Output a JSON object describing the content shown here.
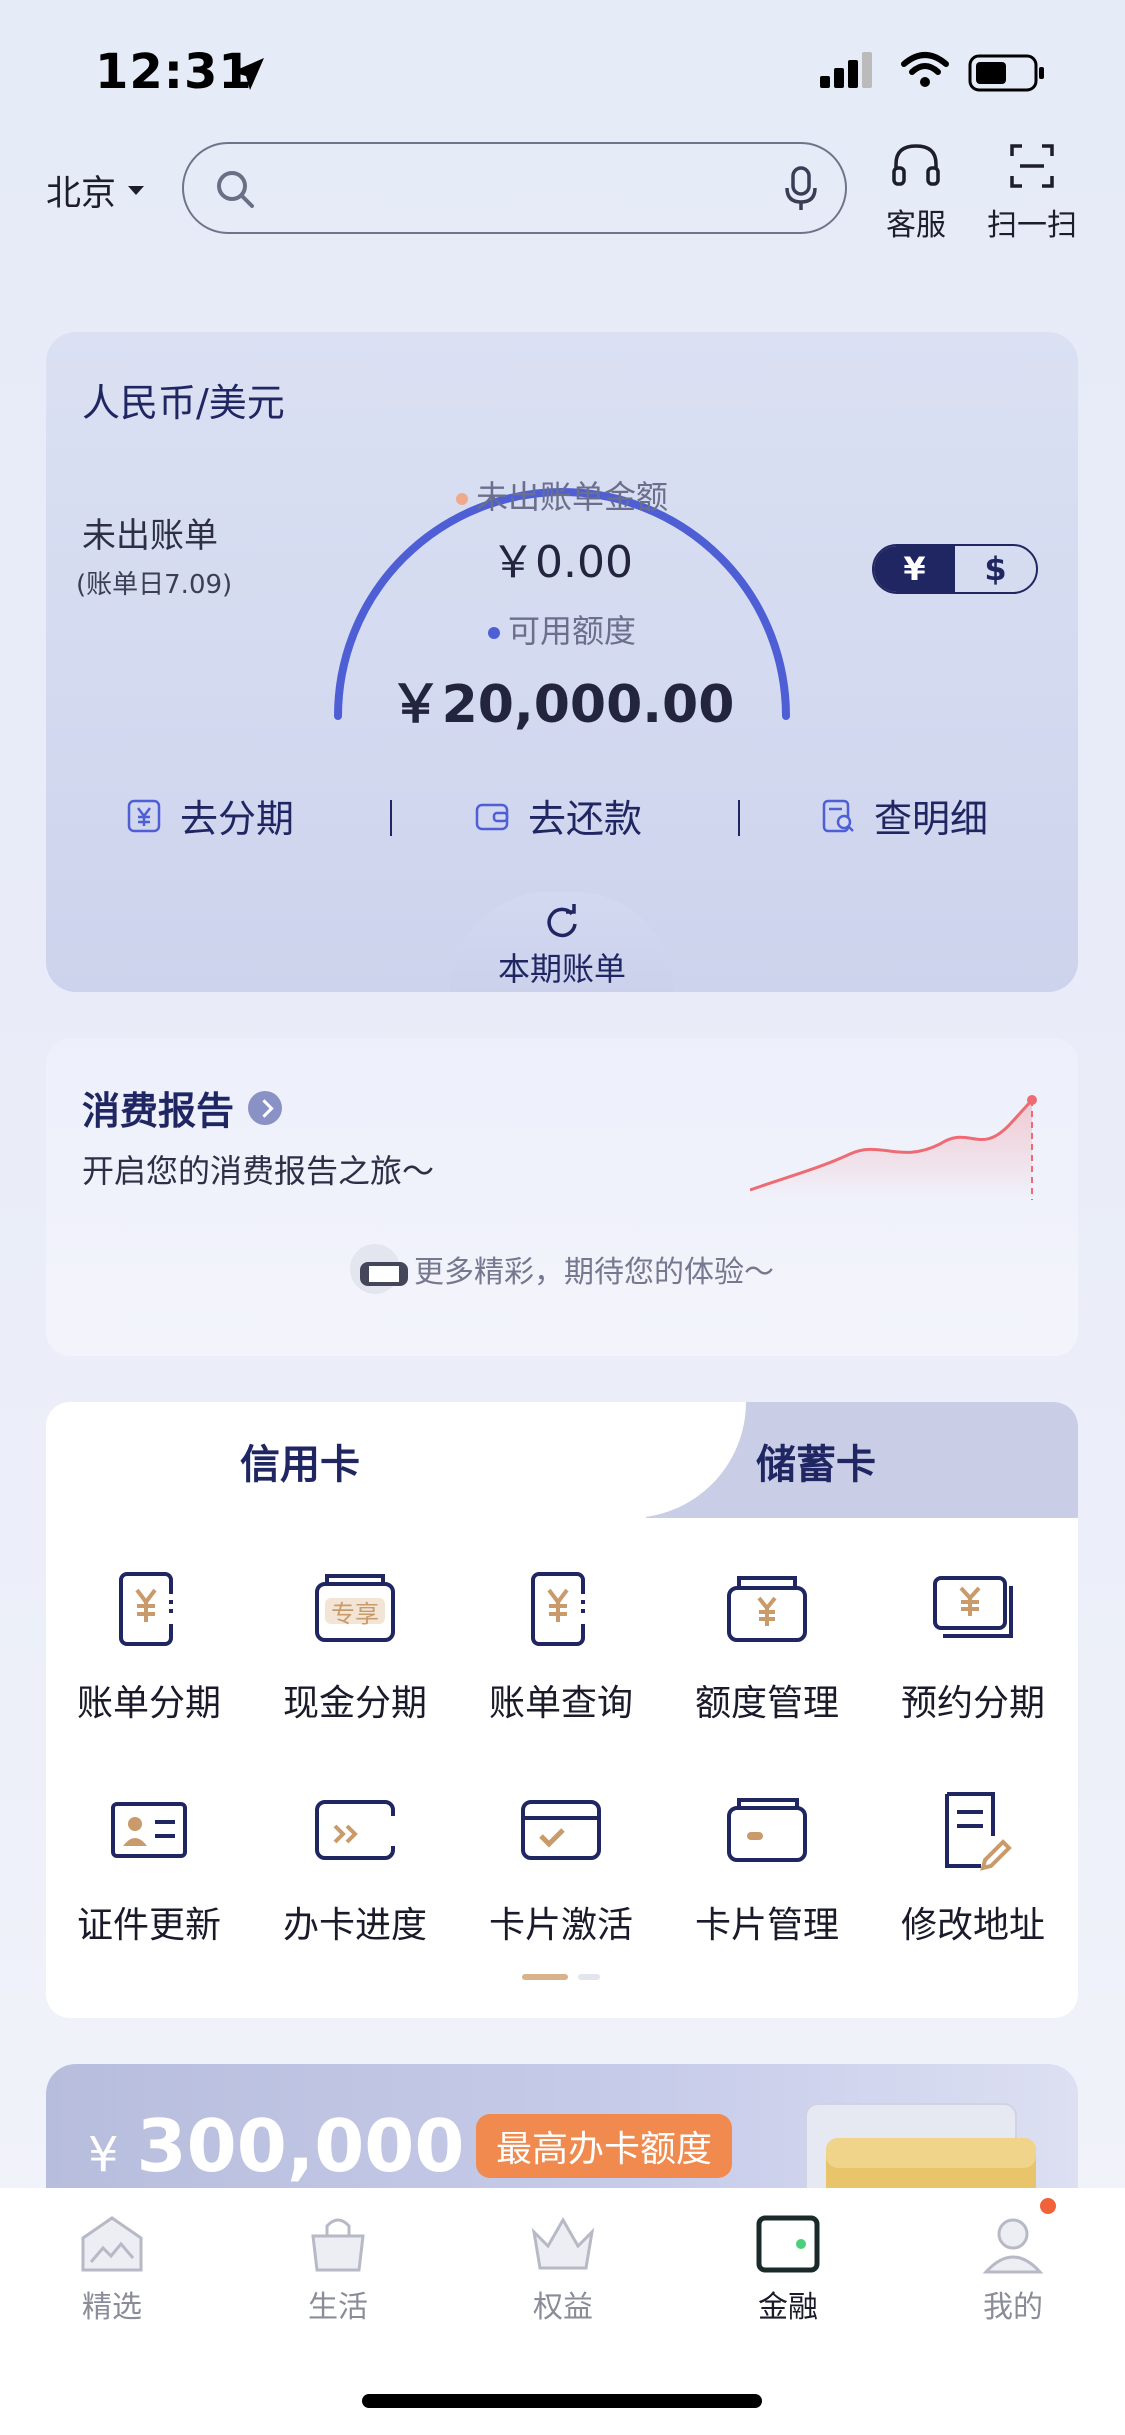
{
  "status_bar": {
    "time": "12:31"
  },
  "header": {
    "city": "北京",
    "search_placeholder": "",
    "customer_service": "客服",
    "scan": "扫一扫"
  },
  "bill": {
    "title": "人民币/美元",
    "unbilled_label": "未出账单",
    "bill_day": "(账单日7.09)",
    "unbilled_amount_label": "未出账单金额",
    "unbilled_amount": "￥0.00",
    "available_credit_label": "可用额度",
    "available_credit": "￥20,000.00",
    "currency_rmb": "¥",
    "currency_usd": "$",
    "actions": [
      "去分期",
      "去还款",
      "查明细"
    ],
    "current_period": "本期账单"
  },
  "report": {
    "title": "消费报告",
    "subtitle": "开启您的消费报告之旅～",
    "more": "更多精彩，期待您的体验～"
  },
  "cards": {
    "tabs": [
      "信用卡",
      "储蓄卡"
    ],
    "active_tab": "信用卡",
    "items": [
      {
        "label": "账单分期",
        "icon": "bill-installment-icon"
      },
      {
        "label": "现金分期",
        "icon": "cash-installment-icon",
        "badge": "专享"
      },
      {
        "label": "账单查询",
        "icon": "bill-query-icon"
      },
      {
        "label": "额度管理",
        "icon": "credit-limit-icon"
      },
      {
        "label": "预约分期",
        "icon": "scheduled-installment-icon"
      },
      {
        "label": "证件更新",
        "icon": "id-update-icon"
      },
      {
        "label": "办卡进度",
        "icon": "application-progress-icon"
      },
      {
        "label": "卡片激活",
        "icon": "card-activation-icon"
      },
      {
        "label": "卡片管理",
        "icon": "card-management-icon"
      },
      {
        "label": "修改地址",
        "icon": "edit-address-icon"
      }
    ]
  },
  "promo": {
    "currency": "¥",
    "amount": "300,000",
    "badge": "最高办卡额度"
  },
  "bottom_nav": [
    {
      "label": "精选",
      "icon": "featured-icon"
    },
    {
      "label": "生活",
      "icon": "life-icon"
    },
    {
      "label": "权益",
      "icon": "benefits-icon"
    },
    {
      "label": "金融",
      "icon": "finance-wallet-icon",
      "active": true
    },
    {
      "label": "我的",
      "icon": "profile-icon"
    }
  ],
  "colors": {
    "primary": "#1f2662",
    "gauge_blue": "#4e5fd6",
    "accent_orange": "#f08a4e",
    "gold": "#c99a6a"
  }
}
